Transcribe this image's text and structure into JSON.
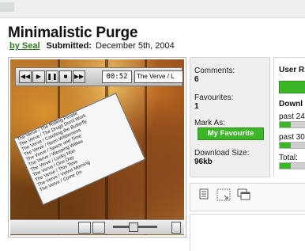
{
  "page": {
    "title": "Minimalistic Purge",
    "author_link": "by Seal",
    "submitted_label": "Submitted:",
    "submitted_date": "December 5th, 2004"
  },
  "player": {
    "time": "00:52",
    "track": "The Verve / L",
    "playlist": [
      "The Verve / The Rolling People",
      "The Verve / The Drugs Don't Work",
      "The Verve / Catching the Butterfly",
      "The Verve / Neon Wilderness",
      "The Verve / Space and Time",
      "The Verve / Weeping Willow",
      "The Verve / Lucky Man",
      "The Verve / One Day",
      "The Verve / This Time",
      "The Verve / Velvet Morning",
      "The Verve / Come On"
    ]
  },
  "stats": {
    "comments_label": "Comments:",
    "comments_value": "6",
    "favourites_label": "Favourites:",
    "favourites_value": "1",
    "mark_as_label": "Mark As:",
    "favourite_button": "My Favourite",
    "download_size_label": "Download Size:",
    "download_size_value": "96kb"
  },
  "rating": {
    "user_rating_label": "User R",
    "downloads_label": "Downl",
    "rows": [
      {
        "label": "past 24",
        "fill": 0.35
      },
      {
        "label": "past 30",
        "fill": 0.35
      },
      {
        "label": "Total:",
        "fill": 0.35
      }
    ]
  },
  "icons": {
    "details": "document-icon",
    "resize": "resize-icon",
    "windows": "windows-icon"
  },
  "colors": {
    "accent_green": "#3cb526",
    "link_green": "#2d7a1c"
  }
}
